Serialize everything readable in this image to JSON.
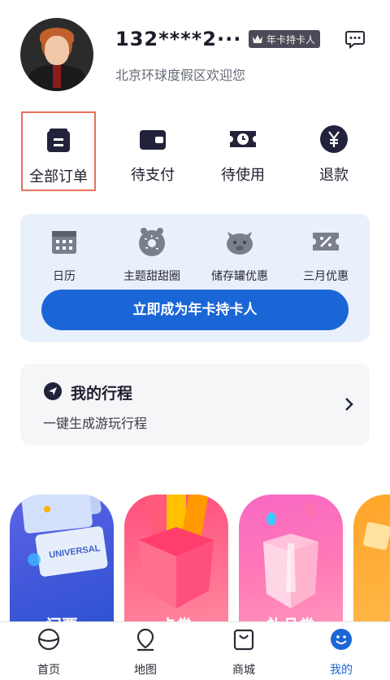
{
  "profile": {
    "username": "132****2···",
    "badge_label": "年卡持卡人",
    "welcome_text": "北京环球度假区欢迎您"
  },
  "orders": {
    "items": [
      {
        "label": "全部订单",
        "icon": "order-list-icon"
      },
      {
        "label": "待支付",
        "icon": "wallet-icon"
      },
      {
        "label": "待使用",
        "icon": "clock-ticket-icon"
      },
      {
        "label": "退款",
        "icon": "yen-refund-icon"
      }
    ],
    "selected_index": 0
  },
  "annual_pass": {
    "benefits": [
      {
        "label": "日历",
        "icon": "calendar-icon"
      },
      {
        "label": "主题甜甜圈",
        "icon": "donut-icon"
      },
      {
        "label": "储存罐优惠",
        "icon": "piggy-bank-icon"
      },
      {
        "label": "三月优惠",
        "icon": "discount-ticket-icon"
      }
    ],
    "cta_label": "立即成为年卡持卡人"
  },
  "itinerary": {
    "title": "我的行程",
    "subtitle": "一键生成游玩行程"
  },
  "cards": [
    {
      "label": "门票"
    },
    {
      "label": "卡券"
    },
    {
      "label": "礼品券"
    },
    {
      "label": ""
    }
  ],
  "ticket_art": {
    "brand": "UNIVERSAL"
  },
  "tabbar": {
    "items": [
      {
        "label": "首页",
        "icon": "home-planet-icon"
      },
      {
        "label": "地图",
        "icon": "map-pin-icon"
      },
      {
        "label": "商城",
        "icon": "shopping-bag-icon"
      },
      {
        "label": "我的",
        "icon": "smiley-profile-icon"
      }
    ],
    "active_index": 3
  },
  "colors": {
    "accent": "#1a66d6",
    "selection_border": "#e8715a",
    "panel_bg": "#e8f0fc"
  }
}
